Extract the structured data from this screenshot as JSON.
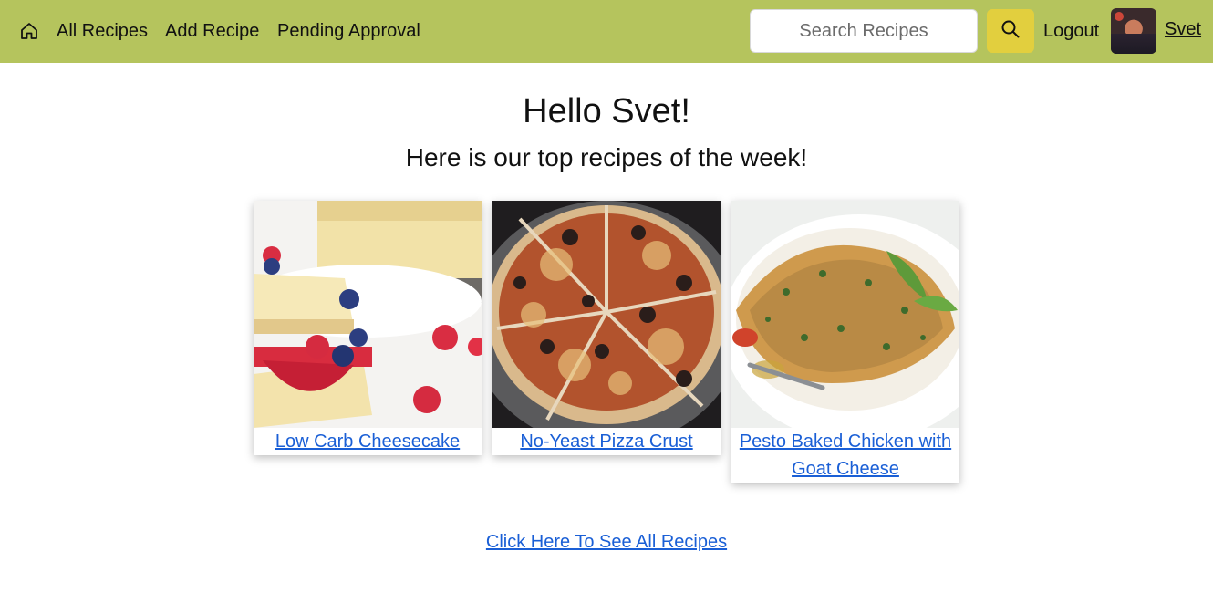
{
  "nav": {
    "home_icon": "home-icon",
    "links": [
      "All Recipes",
      "Add Recipe",
      "Pending Approval"
    ],
    "search_placeholder": "Search Recipes",
    "search_icon": "magnifier-icon",
    "logout": "Logout",
    "username": "Svet",
    "bar_color": "#b5c45d",
    "search_button_color": "#e2cf3e"
  },
  "main": {
    "greeting": "Hello Svet!",
    "subheading": "Here is our top recipes of the week!",
    "recipes": [
      {
        "title": "Low Carb Cheesecake"
      },
      {
        "title": "No-Yeast Pizza Crust"
      },
      {
        "title": "Pesto Baked Chicken with Goat Cheese"
      }
    ],
    "see_all": "Click Here To See All Recipes",
    "link_color": "#1a5fd6"
  }
}
